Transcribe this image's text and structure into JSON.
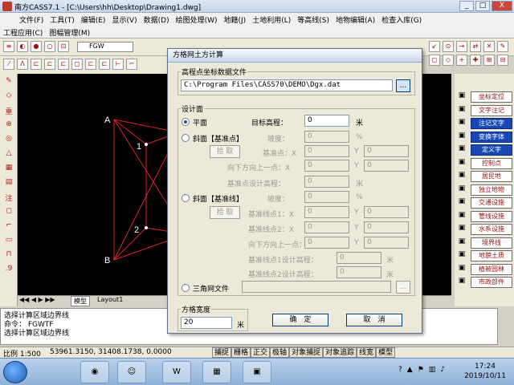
{
  "window": {
    "title": "南方CASS7.1 - [C:\\Users\\hh\\Desktop\\Drawing1.dwg]",
    "min": "_",
    "max": "□",
    "close": "X"
  },
  "menu": {
    "row1": [
      "文件(F)",
      "工具(T)",
      "编辑(E)",
      "显示(V)",
      "数据(D)",
      "绘图处理(W)",
      "地籍(J)",
      "土地利用(L)",
      "等高线(S)",
      "地物编辑(A)",
      "检查入库(G)"
    ],
    "row2": [
      "工程应用(C)",
      "图幅管理(M)"
    ]
  },
  "toolbar": {
    "layer_name": "FGW"
  },
  "canvas": {
    "labels": {
      "A": "A",
      "B": "B",
      "p1": "1",
      "p2": "2"
    }
  },
  "layout_tabs": {
    "model": "模型",
    "layout1": "Layout1"
  },
  "right_panel": [
    "坐标定位",
    "文字注记",
    "注记文字",
    "变换字体",
    "定义字",
    "控制点",
    "居民地",
    "独立地物",
    "交通设施",
    "管线设施",
    "水系设施",
    "境界线",
    "地貌土质",
    "植被园林",
    "市政部件"
  ],
  "command": {
    "line1": "选择计算区域边界线",
    "line2": "命令：  FGWTF",
    "line3": "选择计算区域边界线"
  },
  "status": {
    "scale_label": "比例",
    "scale_value": "1:500",
    "coords": "53961.3150, 31408.1738, 0.0000",
    "toggles": [
      "捕捉",
      "栅格",
      "正交",
      "极轴",
      "对象捕捉",
      "对象追踪",
      "线宽",
      "模型"
    ]
  },
  "clock": {
    "time": "17:24",
    "date": "2019/10/11"
  },
  "dialog": {
    "title": "方格网土方计算",
    "file_group": "高程点坐标数据文件",
    "file_path": "C:\\Program Files\\CASS70\\DEMO\\Dgx.dat",
    "browse": "...",
    "design_group": "设计面",
    "flat": {
      "label": "平面",
      "target_label": "目标高程：",
      "target_value": "0",
      "unit": "米"
    },
    "slope_point": {
      "label": "斜面【基准点】",
      "slope_label": "坡度：",
      "slope_value": "0",
      "slope_unit": "%",
      "pick": "拾 取",
      "base_label": "基准点：X",
      "base_x": "0",
      "base_y": "0",
      "down_label": "向下方向上一点：X",
      "down_x": "0",
      "down_y": "0",
      "height_label": "基准点设计高程：",
      "height_value": "0",
      "unit": "米",
      "y_label": "Y"
    },
    "slope_line": {
      "label": "斜面【基准线】",
      "slope_label": "坡度：",
      "slope_value": "0",
      "slope_unit": "%",
      "pick": "拾 取",
      "l1_label": "基准线点1：X",
      "l1_x": "0",
      "l1_y": "0",
      "l2_label": "基准线点2：X",
      "l2_x": "0",
      "l2_y": "0",
      "down_label": "向下方向上一点：X",
      "down_x": "0",
      "down_y": "0",
      "h1_label": "基准线点1设计高程：",
      "h1_value": "0",
      "h2_label": "基准线点2设计高程：",
      "h2_value": "0",
      "unit": "米",
      "y_label": "Y"
    },
    "tin": {
      "label": "三角网文件",
      "browse": "..."
    },
    "width_group": "方格宽度",
    "width_value": "20",
    "width_unit": "米",
    "ok": "确　定",
    "cancel": "取　消"
  }
}
